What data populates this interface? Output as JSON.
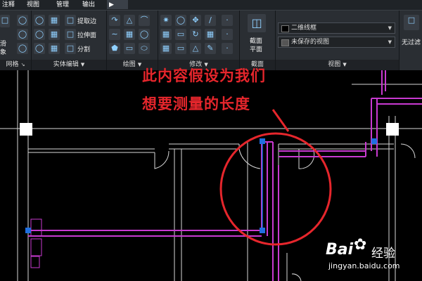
{
  "menu_tabs": [
    "注释",
    "视图",
    "管理",
    "输出"
  ],
  "ribbon": {
    "mesh_group": {
      "btn_label_1": "滑",
      "btn_label_2": "象",
      "title": "网格"
    },
    "solid_edit": {
      "title": "实体编辑",
      "extract_edges": "提取边",
      "extrude_face": "拉伸面",
      "separate": "分割"
    },
    "draw": {
      "title": "绘图"
    },
    "modify": {
      "title": "修改"
    },
    "section": {
      "label_1": "截面",
      "label_2": "平面",
      "title": "截面"
    },
    "view": {
      "visual_style": "二维线框",
      "saved_view": "未保存的视图",
      "title": "视图"
    },
    "filter": {
      "label": "无过滤"
    }
  },
  "annotation": {
    "line1": "此内容假设为我们",
    "line2": "想要测量的长度"
  },
  "watermark": {
    "brand": "Bai",
    "brand2": "经验",
    "url": "jingyan.baidu.com"
  },
  "colors": {
    "annotation_red": "#e6262c",
    "magenta": "#c93ad1",
    "grip_blue": "#1f6fe0",
    "ribbon_bg": "#2a2e33"
  }
}
